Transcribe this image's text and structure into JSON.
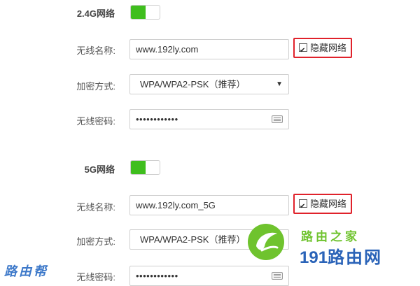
{
  "sections": [
    {
      "title": "2.4G网络",
      "ssid_label": "无线名称:",
      "ssid_value": "www.192ly.com",
      "hide_label": "隐藏网络",
      "encrypt_label": "加密方式:",
      "encrypt_value": "WPA/WPA2-PSK（推荐）",
      "password_label": "无线密码:",
      "password_value": "••••••••••••"
    },
    {
      "title": "5G网络",
      "ssid_label": "无线名称:",
      "ssid_value": "www.192ly.com_5G",
      "hide_label": "隐藏网络",
      "encrypt_label": "加密方式:",
      "encrypt_value": "WPA/WPA2-PSK（推荐）",
      "password_label": "无线密码:",
      "password_value": "••••••••••••"
    }
  ],
  "watermarks": {
    "brand_cn": "路由之家",
    "brand_num": "191",
    "brand_cn2": "路由网",
    "left_mark": "路由帮"
  },
  "colors": {
    "toggle_on": "#3fbe1e",
    "highlight_border": "#e0222b",
    "watermark_green": "#6fc32e",
    "watermark_blue": "#2a63b8"
  },
  "icons": [
    "toggle-on",
    "checkbox-checked",
    "dropdown-arrow",
    "keyboard-icon",
    "leaf-logo-icon"
  ]
}
